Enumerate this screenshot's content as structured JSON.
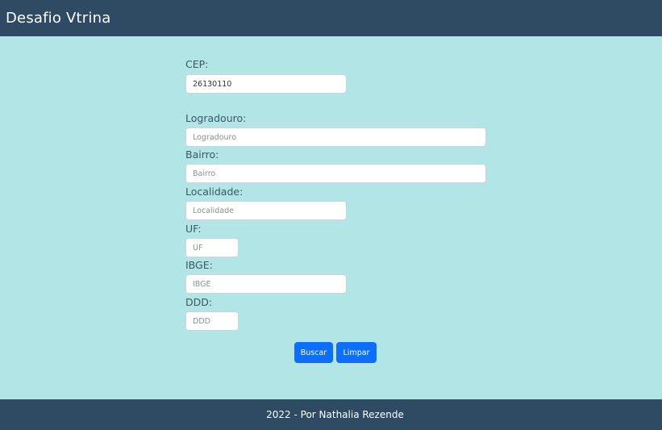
{
  "header": {
    "title": "Desafio Vtrina"
  },
  "form": {
    "cep": {
      "label": "CEP:",
      "value": "26130110"
    },
    "logradouro": {
      "label": "Logradouro:",
      "placeholder": "Logradouro"
    },
    "bairro": {
      "label": "Bairro:",
      "placeholder": "Bairro"
    },
    "localidade": {
      "label": "Localidade:",
      "placeholder": "Localidade"
    },
    "uf": {
      "label": "UF:",
      "placeholder": "UF"
    },
    "ibge": {
      "label": "IBGE:",
      "placeholder": "IBGE"
    },
    "ddd": {
      "label": "DDD:",
      "placeholder": "DDD"
    },
    "buttons": {
      "search_label": "Buscar",
      "clear_label": "Limpar"
    }
  },
  "footer": {
    "text": "2022 - Por Nathalia Rezende"
  },
  "colors": {
    "navbar": "#2f4b63",
    "background": "#b2e6e6",
    "button": "#0d6efd"
  }
}
